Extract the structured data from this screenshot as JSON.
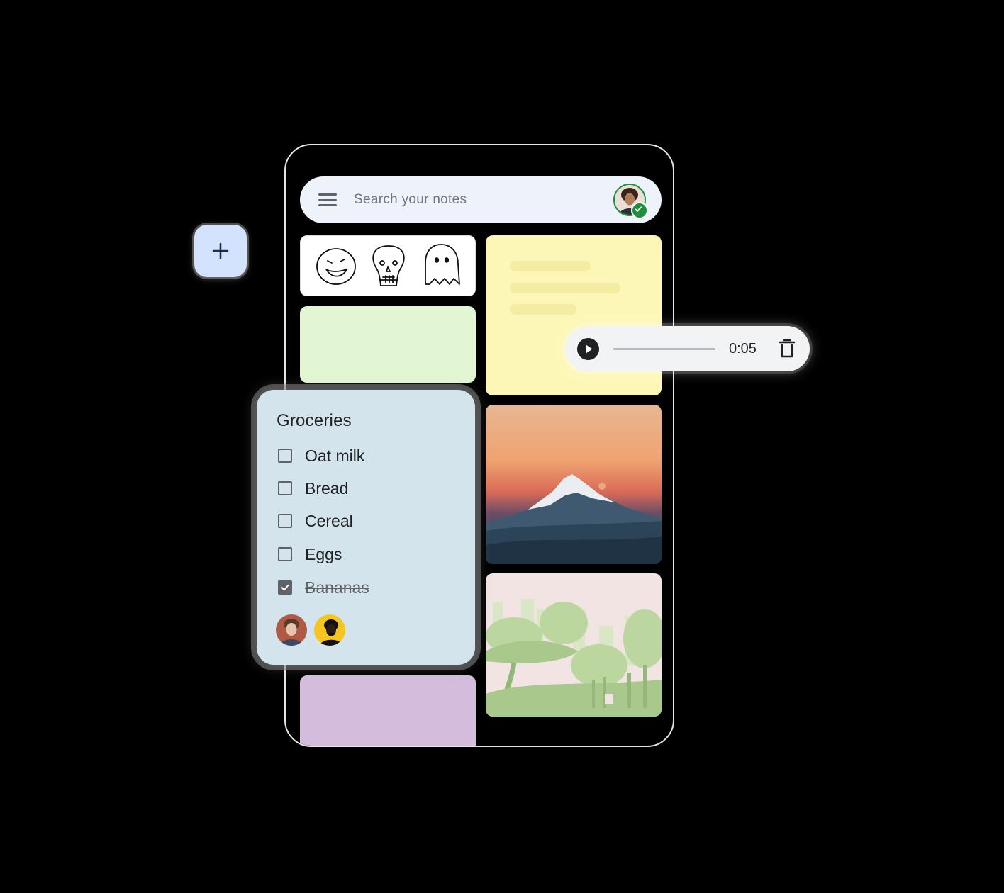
{
  "search": {
    "placeholder": "Search your notes"
  },
  "fab": {
    "icon": "plus-icon"
  },
  "audio": {
    "time": "0:05",
    "play_icon": "play-icon",
    "delete_icon": "trash-icon"
  },
  "groceries": {
    "title": "Groceries",
    "items": [
      {
        "label": "Oat milk",
        "checked": false
      },
      {
        "label": "Bread",
        "checked": false
      },
      {
        "label": "Cereal",
        "checked": false
      },
      {
        "label": "Eggs",
        "checked": false
      },
      {
        "label": "Bananas",
        "checked": true
      }
    ]
  },
  "colors": {
    "search_bg": "#eef2fb",
    "fab_bg": "#d3e3fd",
    "note_yellow": "#fdf7b7",
    "note_green": "#e2f6d3",
    "note_blue": "#d4e4ed",
    "note_purple": "#d3bcdc",
    "account_ring": "#1e8e3e"
  }
}
